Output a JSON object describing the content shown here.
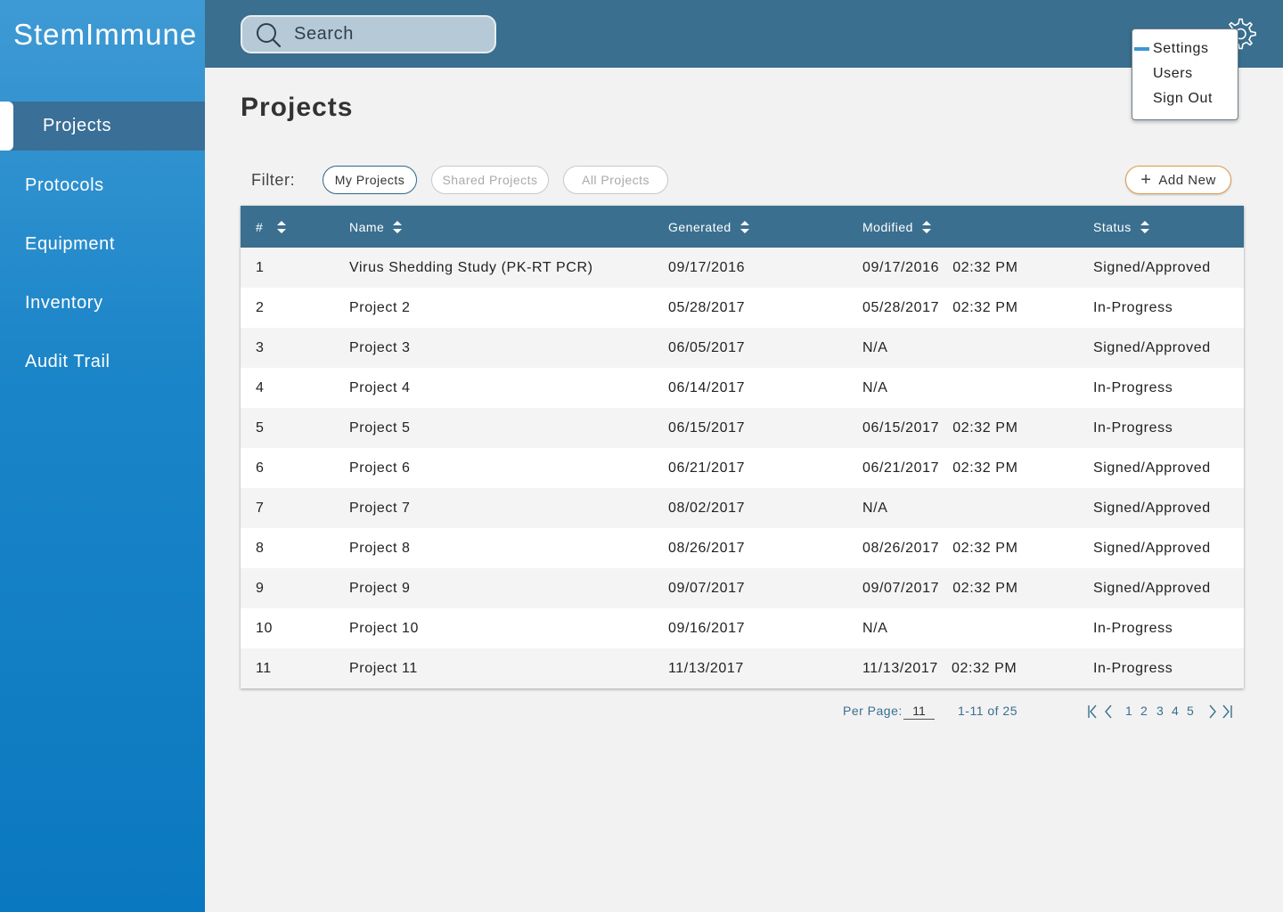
{
  "app": {
    "logo": "StemImmune"
  },
  "sidebar": {
    "items": [
      {
        "label": "Projects",
        "active": true
      },
      {
        "label": "Protocols"
      },
      {
        "label": "Equipment"
      },
      {
        "label": "Inventory"
      },
      {
        "label": "Audit Trail"
      }
    ]
  },
  "header": {
    "search_placeholder": "Search",
    "menu": [
      "Settings",
      "Users",
      "Sign Out"
    ]
  },
  "main": {
    "title": "Projects",
    "filter_label": "Filter:",
    "filters": [
      "My Projects",
      "Shared Projects",
      "All Projects"
    ],
    "add_new": "Add New"
  },
  "table": {
    "headers": [
      "#",
      "Name",
      "Generated",
      "Modified",
      "Status"
    ],
    "rows": [
      [
        "1",
        "Virus Shedding Study (PK-RT PCR)",
        "09/17/2016",
        "09/17/2016   02:32 PM",
        "Signed/Approved"
      ],
      [
        "2",
        "Project 2",
        "05/28/2017",
        "05/28/2017   02:32 PM",
        "In-Progress"
      ],
      [
        "3",
        "Project 3",
        "06/05/2017",
        "N/A",
        "Signed/Approved"
      ],
      [
        "4",
        "Project 4",
        "06/14/2017",
        "N/A",
        "In-Progress"
      ],
      [
        "5",
        "Project 5",
        "06/15/2017",
        "06/15/2017   02:32 PM",
        "In-Progress"
      ],
      [
        "6",
        "Project 6",
        "06/21/2017",
        "06/21/2017   02:32 PM",
        "Signed/Approved"
      ],
      [
        "7",
        "Project 7",
        "08/02/2017",
        "N/A",
        "Signed/Approved"
      ],
      [
        "8",
        "Project 8",
        "08/26/2017",
        "08/26/2017   02:32 PM",
        "Signed/Approved"
      ],
      [
        "9",
        "Project 9",
        "09/07/2017",
        "09/07/2017   02:32 PM",
        "Signed/Approved"
      ],
      [
        "10",
        "Project 10",
        "09/16/2017",
        "N/A",
        "In-Progress"
      ],
      [
        "11",
        "Project 11",
        "11/13/2017",
        "11/13/2017   02:32 PM",
        "In-Progress"
      ]
    ]
  },
  "pagination": {
    "per_page_label": "Per Page:",
    "per_page_value": "11",
    "range": "1-11 of 25",
    "pages": [
      "1",
      "2",
      "3",
      "4",
      "5"
    ]
  },
  "colors": {
    "header_bg": "#3a6f8f",
    "sidebar_top": "#3f9ad4",
    "sidebar_bottom": "#0a78c0",
    "accent_orange": "#e39a4a",
    "accent_blue": "#3b97d4"
  }
}
